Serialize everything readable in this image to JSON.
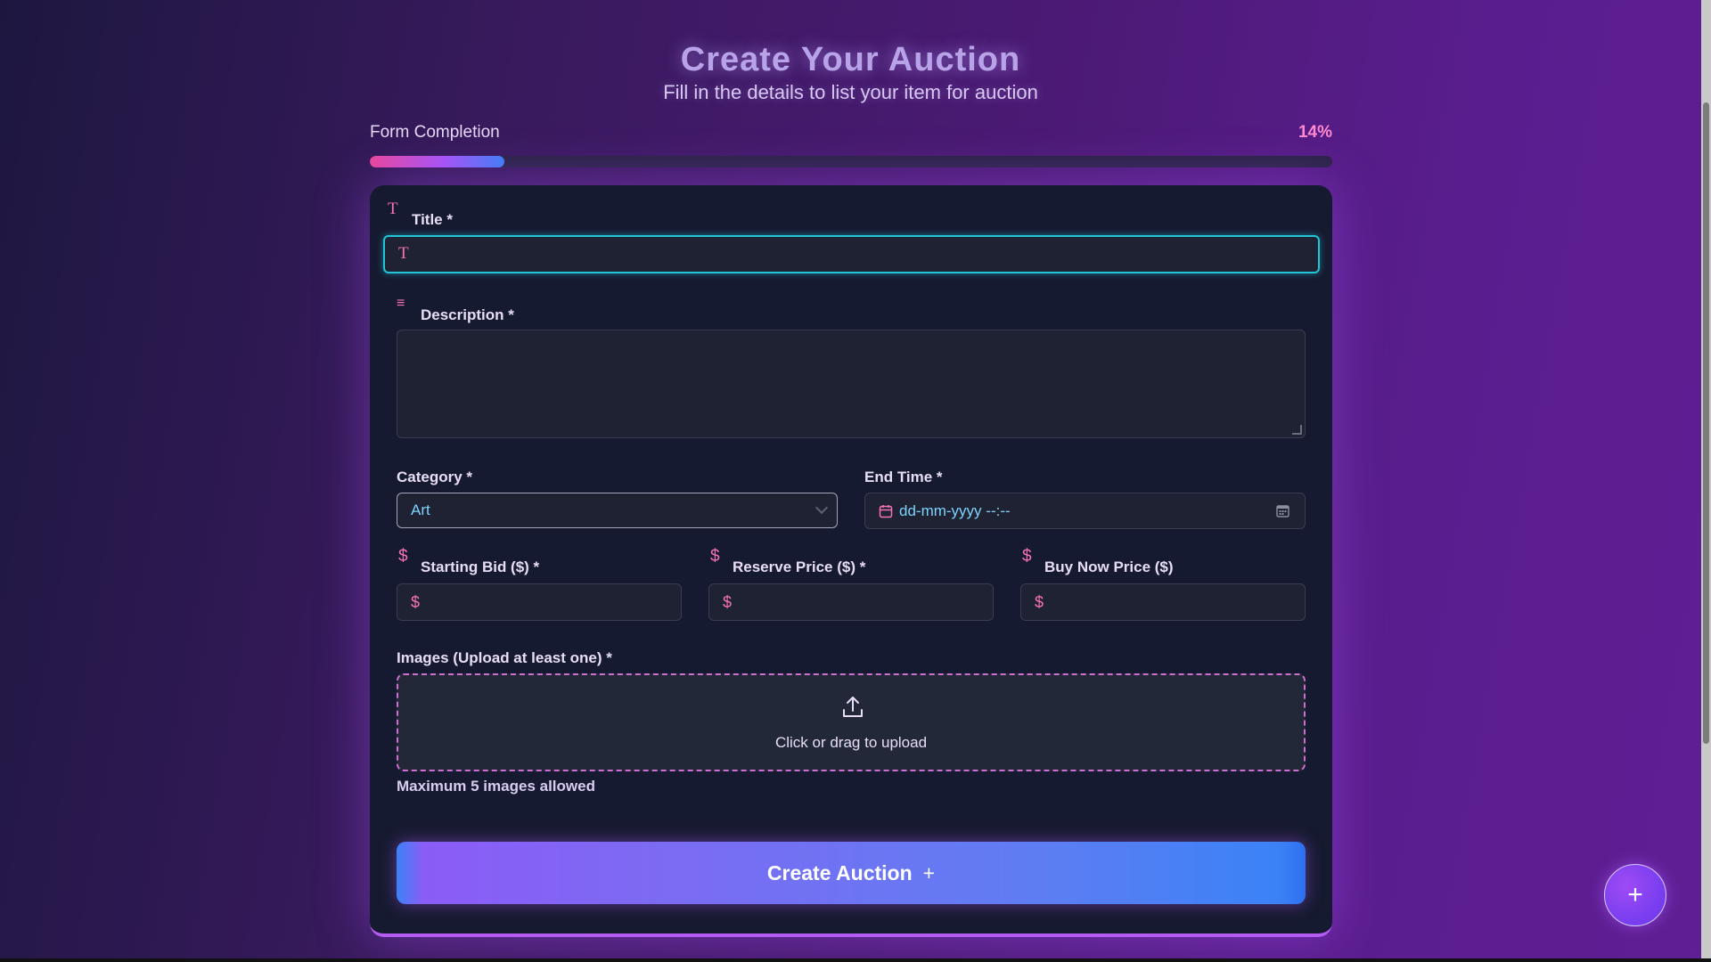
{
  "header": {
    "title": "Create Your Auction",
    "subtitle": "Fill in the details to list your item for auction"
  },
  "progress": {
    "label": "Form Completion",
    "percent_text": "14%",
    "percent": 14
  },
  "form": {
    "title_label": "Title *",
    "title_value": "",
    "description_label": "Description *",
    "description_value": "",
    "category_label": "Category *",
    "category_value": "Art",
    "end_time_label": "End Time *",
    "end_time_placeholder": "dd-mm-yyyy --:--",
    "starting_bid_label": "Starting Bid ($) *",
    "reserve_price_label": "Reserve Price ($) *",
    "buy_now_label": "Buy Now Price ($)",
    "currency_symbol": "$",
    "images_label": "Images (Upload at least one) *",
    "upload_text": "Click or drag to upload",
    "max_images_note": "Maximum 5 images allowed",
    "submit_label": "Create Auction",
    "submit_icon": "+"
  },
  "fab": {
    "icon": "+"
  },
  "icons": {
    "title_icon": "T",
    "description_icon": "≡",
    "upload_icon": "upload-icon",
    "calendar_icon": "calendar-icon"
  },
  "colors": {
    "accent_pink": "#f472b6",
    "accent_cyan": "#22c4d8",
    "accent_purple": "#8b5cf6",
    "accent_blue": "#3b82f6"
  }
}
